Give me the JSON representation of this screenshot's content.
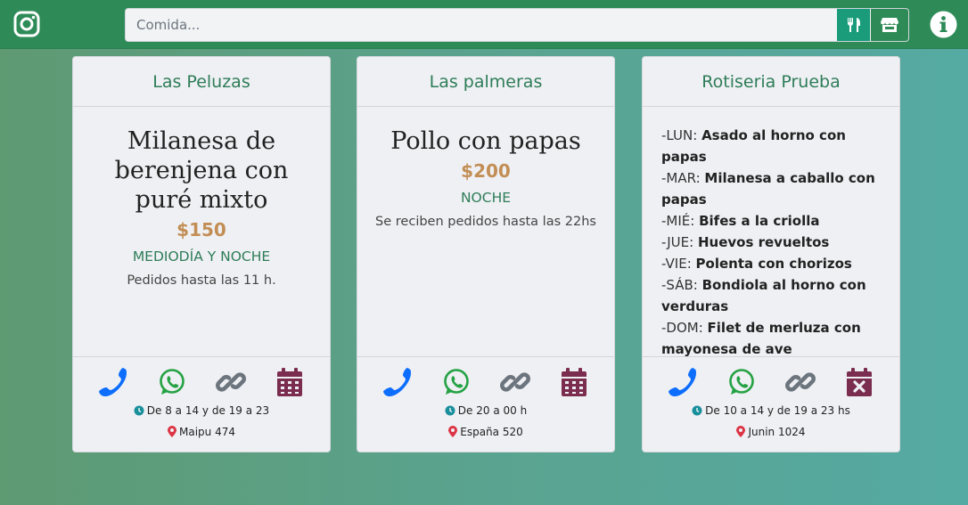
{
  "navbar": {
    "search": {
      "placeholder": "Comida...",
      "value": ""
    },
    "brand_color": "#2e8b57",
    "icons": [
      "instagram-icon",
      "utensils-icon",
      "store-icon",
      "info-icon"
    ]
  },
  "cards": [
    {
      "name": "Las Peluzas",
      "dish": "Milanesa de berenjena con puré mixto",
      "price": "$150",
      "shift": "MEDIODÍA Y NOCHE",
      "note": "Pedidos hasta las 11 h.",
      "hours": "De 8 a 14 y de 19 a 23",
      "address": "Maipu 474",
      "calendar": "calendar-icon"
    },
    {
      "name": "Las palmeras",
      "dish": "Pollo con papas",
      "price": "$200",
      "shift": "NOCHE",
      "note": "Se reciben pedidos hasta las 22hs",
      "hours": "De 20 a 00 h",
      "address": "España 520",
      "calendar": "calendar-icon"
    },
    {
      "name": "Rotiseria Prueba",
      "menu": [
        {
          "day": "-LUN:",
          "dish": "Asado al horno con papas"
        },
        {
          "day": "-MAR:",
          "dish": "Milanesa a caballo con"
        },
        {
          "day": "",
          "dish": "papas"
        },
        {
          "day": "-MIÉ:",
          "dish": "Bifes a la criolla"
        },
        {
          "day": "-JUE:",
          "dish": "Huevos revueltos"
        },
        {
          "day": "-VIE:",
          "dish": "Polenta con chorizos"
        },
        {
          "day": "-SÁB:",
          "dish": "Bondiola al horno con"
        },
        {
          "day": "",
          "dish": "verduras"
        },
        {
          "day": "-DOM:",
          "dish": "Filet de merluza con"
        },
        {
          "day": "",
          "dish": "mayonesa de ave"
        }
      ],
      "hours": "De 10 a 14 y de 19 a 23 hs",
      "address": "Junin 1024",
      "calendar": "calendar-x-icon"
    }
  ],
  "colors": {
    "phone": "#0d6efd",
    "whatsapp": "#25a244",
    "link": "#6c757d",
    "calendar": "#7b2d4f",
    "price": "#c28e55",
    "title": "#2e7d58"
  }
}
